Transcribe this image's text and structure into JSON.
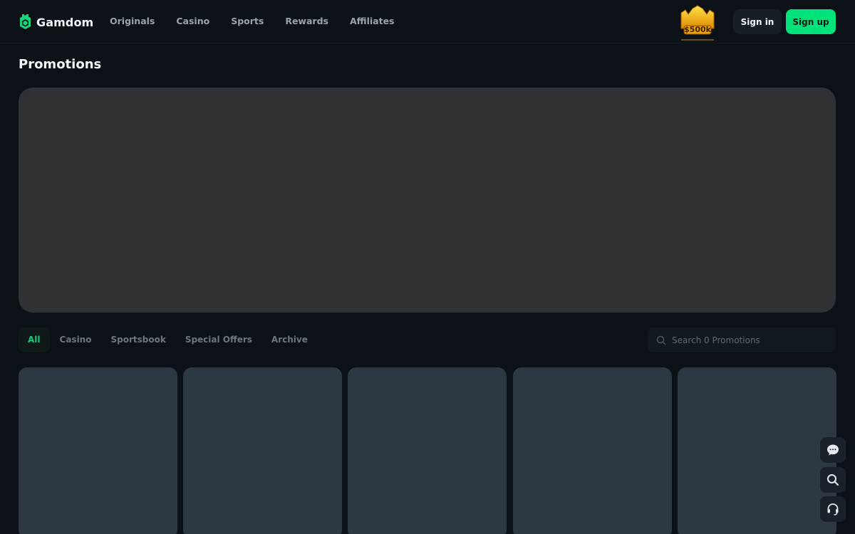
{
  "header": {
    "brand": "Gamdom",
    "nav": [
      {
        "label": "Originals"
      },
      {
        "label": "Casino"
      },
      {
        "label": "Sports"
      },
      {
        "label": "Rewards"
      },
      {
        "label": "Affiliates"
      }
    ],
    "promo_badge": "$500k",
    "signin_label": "Sign in",
    "signup_label": "Sign up"
  },
  "page": {
    "title": "Promotions"
  },
  "tabs": [
    {
      "label": "All",
      "active": true
    },
    {
      "label": "Casino",
      "active": false
    },
    {
      "label": "Sportsbook",
      "active": false
    },
    {
      "label": "Special Offers",
      "active": false
    },
    {
      "label": "Archive",
      "active": false
    }
  ],
  "search": {
    "placeholder": "Search 0 Promotions",
    "value": ""
  },
  "floating_actions": [
    {
      "icon": "chat-icon"
    },
    {
      "icon": "search-icon"
    },
    {
      "icon": "headset-icon"
    }
  ],
  "colors": {
    "background": "#0b1116",
    "accent": "#00e37a",
    "active_tab": "#19c77a",
    "hero_placeholder": "#2e3235",
    "card_placeholder": "#2d3942"
  }
}
